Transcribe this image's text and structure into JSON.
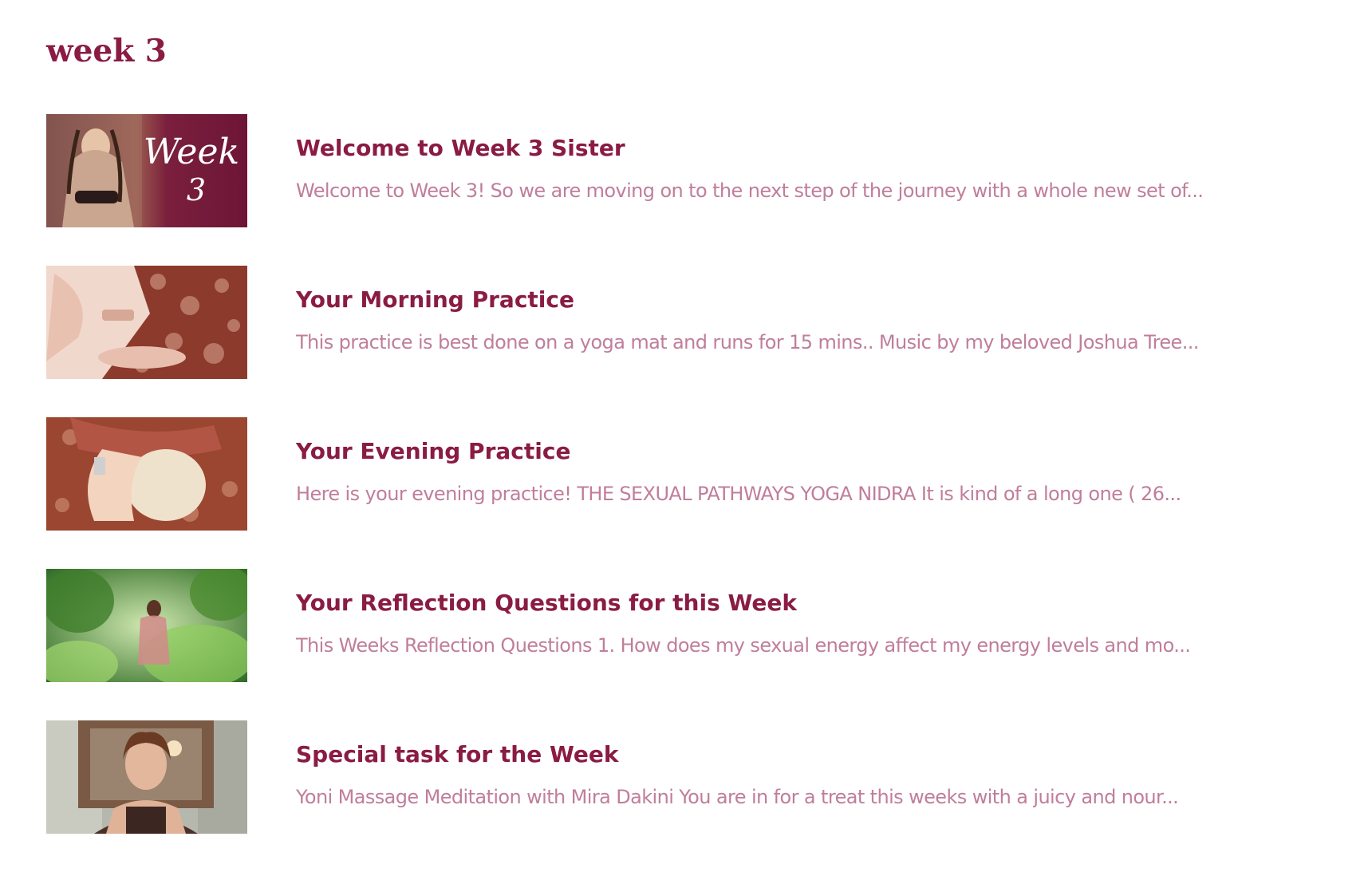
{
  "section": {
    "title": "week 3"
  },
  "lessons": [
    {
      "title": "Welcome to Week 3 Sister",
      "excerpt": "Welcome to Week 3! So we are moving on to the next step of the journey with a whole new set of...",
      "thumbnail": {
        "overlay_line1": "Week",
        "overlay_line2": "3"
      }
    },
    {
      "title": "Your Morning Practice",
      "excerpt": "This practice is best done on a yoga mat and runs for 15 mins.. Music by my beloved  Joshua Tree..."
    },
    {
      "title": "Your Evening Practice",
      "excerpt": "Here is your evening practice! THE SEXUAL PATHWAYS YOGA NIDRA   It is kind of a long one ( 26..."
    },
    {
      "title": "Your Reflection Questions for this Week",
      "excerpt": "This Weeks Reflection Questions   1. How does my sexual energy affect my energy levels and mo..."
    },
    {
      "title": "Special task for the Week",
      "excerpt": "Yoni Massage Meditation with Mira Dakini You are in for a treat this weeks with a juicy and nour..."
    }
  ],
  "colors": {
    "title": "#8a1c44",
    "excerpt": "#c07e9b",
    "background": "#ffffff"
  }
}
